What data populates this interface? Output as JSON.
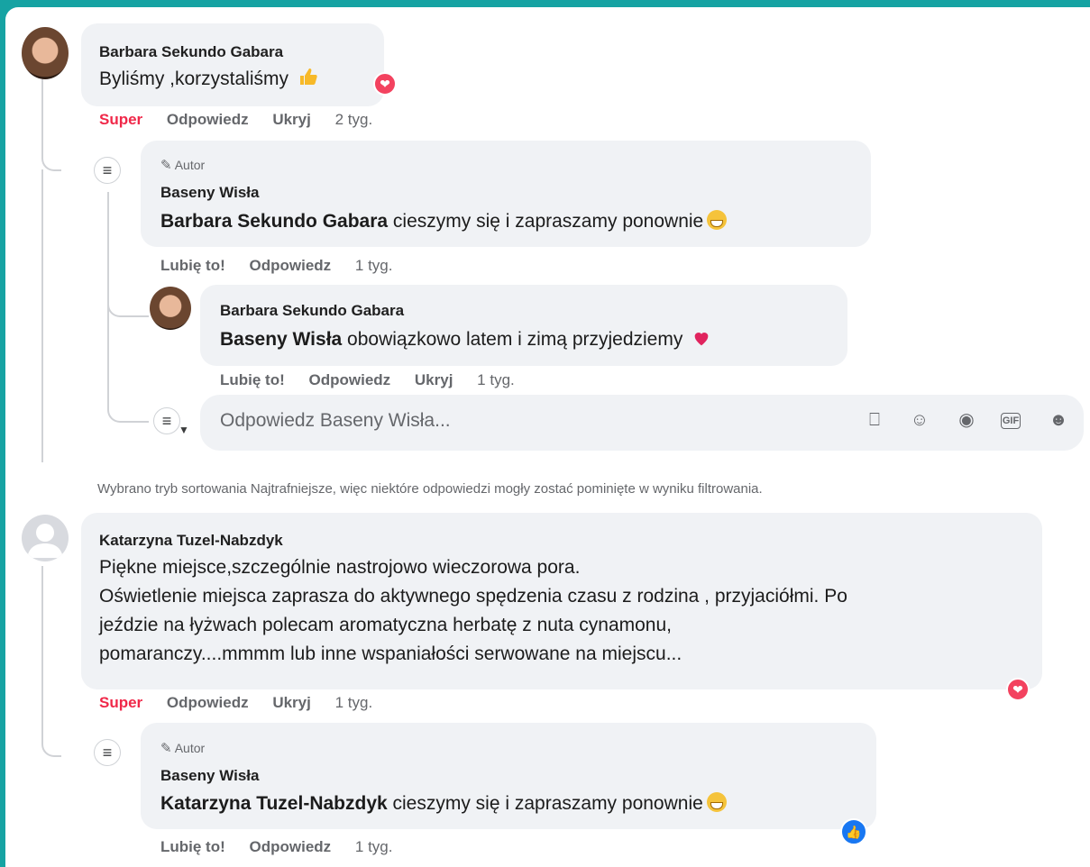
{
  "thread1": {
    "comment": {
      "author": "Barbara Sekundo Gabara",
      "text": "Byliśmy ,korzystaliśmy",
      "actions": {
        "react": "Super",
        "reply": "Odpowiedz",
        "hide": "Ukryj",
        "time": "2 tyg."
      }
    },
    "page_reply": {
      "badge": "Autor",
      "author": "Baseny Wisła",
      "mention": "Barbara Sekundo Gabara",
      "text": " cieszymy się i zapraszamy ponownie",
      "actions": {
        "like": "Lubię to!",
        "reply": "Odpowiedz",
        "time": "1 tyg."
      }
    },
    "user_reply": {
      "author": "Barbara Sekundo Gabara",
      "mention": "Baseny Wisła",
      "text": " obowiązkowo latem i zimą przyjedziemy",
      "actions": {
        "like": "Lubię to!",
        "reply": "Odpowiedz",
        "hide": "Ukryj",
        "time": "1 tyg."
      }
    },
    "reply_input": {
      "placeholder": "Odpowiedz Baseny Wisła..."
    }
  },
  "sort_notice": "Wybrano tryb sortowania Najtrafniejsze, więc niektóre odpowiedzi mogły zostać pominięte w wyniku filtrowania.",
  "thread2": {
    "comment": {
      "author": "Katarzyna Tuzel-Nabzdyk",
      "lines": [
        "Piękne miejsce,szczególnie nastrojowo wieczorowa pora.",
        "Oświetlenie miejsca zaprasza do aktywnego spędzenia czasu z rodzina , przyjaciółmi. Po",
        "jeździe na łyżwach polecam aromatyczna herbatę z nuta cynamonu,",
        "pomaranczy....mmmm lub inne wspaniałości serwowane na miejscu..."
      ],
      "actions": {
        "react": "Super",
        "reply": "Odpowiedz",
        "hide": "Ukryj",
        "time": "1 tyg."
      }
    },
    "page_reply": {
      "badge": "Autor",
      "author": "Baseny Wisła",
      "mention": "Katarzyna Tuzel-Nabzdyk",
      "text": " cieszymy się i zapraszamy ponownie",
      "actions": {
        "like": "Lubię to!",
        "reply": "Odpowiedz",
        "time": "1 tyg."
      }
    }
  },
  "colors": {
    "frame": "#16a3a3",
    "bubble": "#f0f2f5",
    "super": "#f02849",
    "meta": "#65676b",
    "heart": "#f3425f",
    "like": "#1877f2"
  },
  "icons": [
    "heart-reaction-icon",
    "like-reaction-icon",
    "pencil-icon",
    "page-logo-icon",
    "avatar-icon",
    "sticker-icon",
    "emoji-icon",
    "camera-icon",
    "gif-icon",
    "sticker-smile-icon"
  ]
}
